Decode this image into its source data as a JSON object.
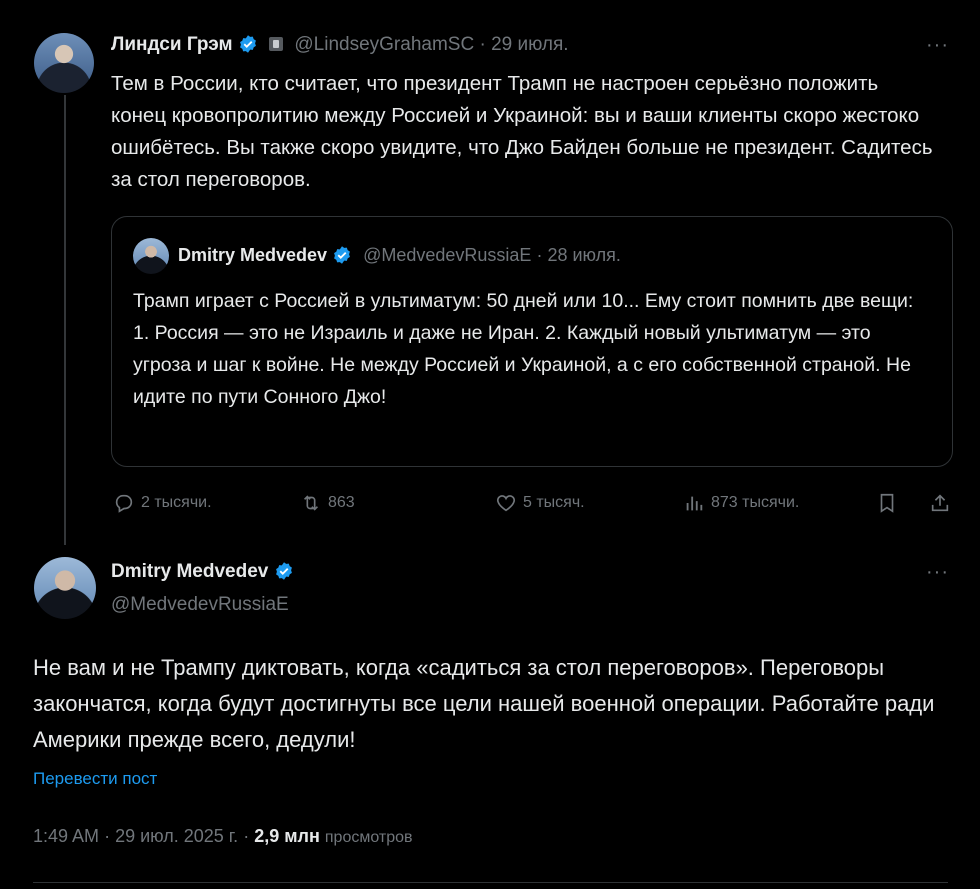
{
  "tweet1": {
    "name": "Линдси Грэм",
    "handle": "@LindseyGrahamSC",
    "date": "29 июля.",
    "separator": "·",
    "text": "Тем в России, кто считает, что президент Трамп не настроен серьёзно положить конец кровопролитию между Россией и Украиной: вы и ваши клиенты скоро жестоко ошибётесь. Вы также скоро увидите, что Джо Байден больше не президент. Садитесь за стол переговоров.",
    "more": "···",
    "quote": {
      "name": "Dmitry Medvedev",
      "handle": "@MedvedevRussiaE",
      "date": "28 июля.",
      "separator": "·",
      "text": "Трамп играет с Россией в ультиматум: 50 дней или 10... Ему стоит помнить две вещи: 1. Россия — это не Израиль и даже не Иран. 2. Каждый новый ультиматум — это угроза и шаг к войне. Не между Россией и Украиной, а с его собственной страной. Не идите по пути Сонного Джо!"
    },
    "actions": {
      "replies": "2 тысячи.",
      "retweets": "863",
      "likes": "5 тысяч.",
      "views": "873 тысячи."
    }
  },
  "tweet2": {
    "name": "Dmitry Medvedev",
    "handle": "@MedvedevRussiaE",
    "more": "···",
    "text": "Не вам и не Трампу диктовать, когда «садиться за стол переговоров». Переговоры закончатся, когда будут достигнуты все цели нашей военной операции. Работайте ради Америки прежде всего, дедули!",
    "translate": "Перевести пост",
    "time": "1:49 AM",
    "date": "29 июл. 2025 г.",
    "views_count": "2,9 млн",
    "views_label": "просмотров",
    "dot": "·"
  },
  "colors": {
    "background": "#000000",
    "text": "#e7e9ea",
    "muted": "#71767b",
    "link": "#1d9bf0",
    "verified": "#1d9bf0",
    "border": "#2f3336"
  },
  "icons": [
    "verified-badge-icon",
    "government-label-icon",
    "more-icon",
    "reply-icon",
    "retweet-icon",
    "like-icon",
    "views-icon",
    "bookmark-icon",
    "share-icon"
  ]
}
